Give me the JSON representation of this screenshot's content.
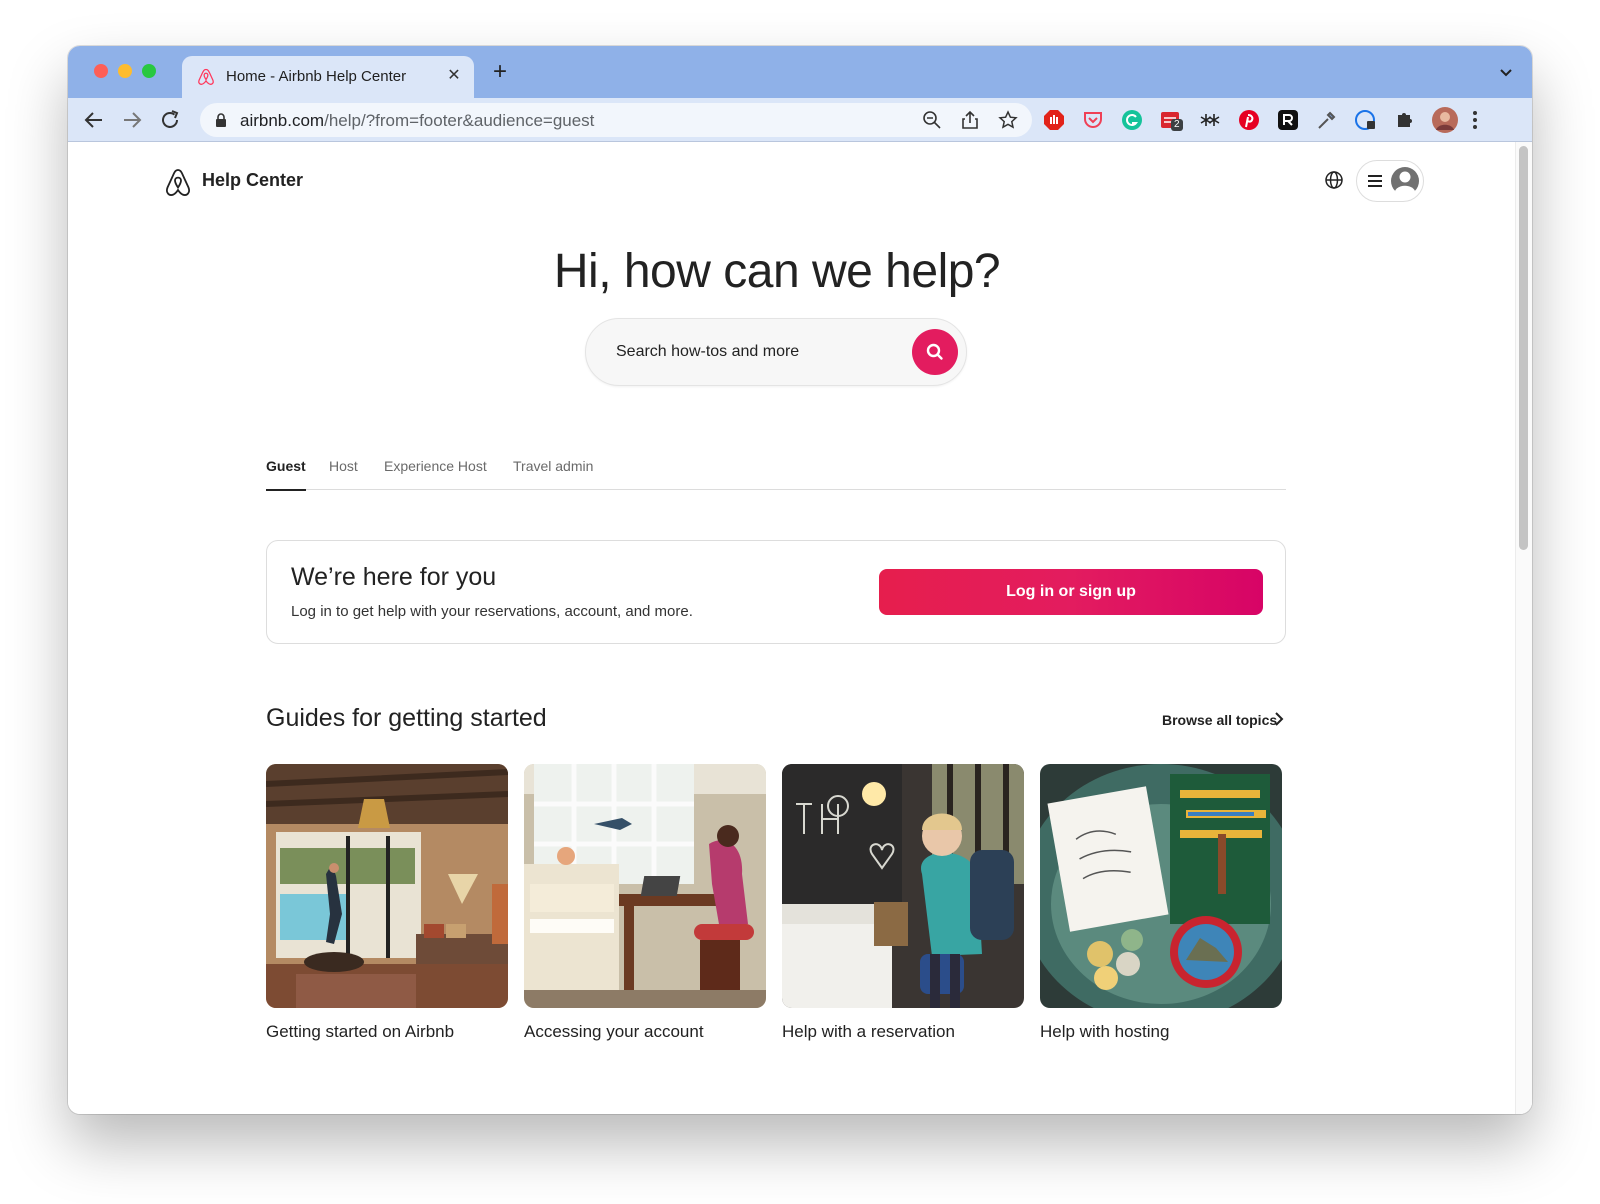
{
  "browser": {
    "tab_title": "Home - Airbnb Help Center",
    "url_host": "airbnb.com",
    "url_rest": "/help/?from=footer&audience=guest",
    "extension_badge": "2"
  },
  "header": {
    "title": "Help Center"
  },
  "hero": {
    "title": "Hi, how can we help?",
    "search_placeholder": "Search how-tos and more"
  },
  "tabs": [
    {
      "label": "Guest",
      "active": true
    },
    {
      "label": "Host",
      "active": false
    },
    {
      "label": "Experience Host",
      "active": false
    },
    {
      "label": "Travel admin",
      "active": false
    }
  ],
  "promo": {
    "title": "We’re here for you",
    "subtitle": "Log in to get help with your reservations, account, and more.",
    "button_label": "Log in or sign up"
  },
  "guides": {
    "title": "Guides for getting started",
    "browse_label": "Browse all topics",
    "cards": [
      {
        "title": "Getting started on Airbnb",
        "image": "living-room-photo"
      },
      {
        "title": "Accessing your account",
        "image": "home-office-photo"
      },
      {
        "title": "Help with a reservation",
        "image": "traveler-photo"
      },
      {
        "title": "Help with hosting",
        "image": "welcome-note-photo"
      }
    ]
  },
  "colors": {
    "brand": "#e31c5f",
    "tabstrip": "#8fb1e8",
    "toolbar": "#dbe6f8"
  }
}
